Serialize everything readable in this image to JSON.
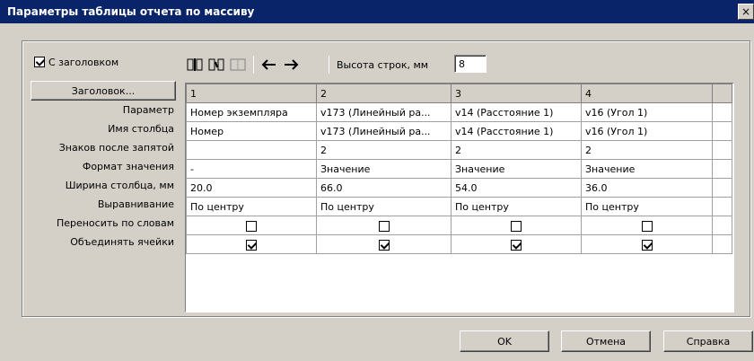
{
  "window": {
    "title": "Параметры таблицы отчета по массиву",
    "close_label": "×"
  },
  "header_checkbox": {
    "label": "С заголовком",
    "checked": true
  },
  "header_button_label": "Заголовок...",
  "row_height": {
    "label": "Высота строк, мм",
    "value": "8"
  },
  "row_labels": [
    "Параметр",
    "Имя столбца",
    "Знаков после запятой",
    "Формат значения",
    "Ширина столбца, мм",
    "Выравнивание",
    "Переносить по словам",
    "Объединять ячейки"
  ],
  "grid": {
    "headers": [
      "1",
      "2",
      "3",
      "4"
    ],
    "columns": [
      {
        "param": "Номер экземпляра",
        "name": "Номер",
        "decimals": "",
        "format": "-",
        "width": "20.0",
        "align": "По центру",
        "wrap": false,
        "merge": true
      },
      {
        "param": "v173 (Линейный ра...",
        "name": "v173 (Линейный ра...",
        "decimals": "2",
        "format": "Значение",
        "width": "66.0",
        "align": "По центру",
        "wrap": false,
        "merge": true
      },
      {
        "param": "v14 (Расстояние 1)",
        "name": "v14 (Расстояние 1)",
        "decimals": "2",
        "format": "Значение",
        "width": "54.0",
        "align": "По центру",
        "wrap": false,
        "merge": true
      },
      {
        "param": "v16 (Угол 1)",
        "name": "v16 (Угол 1)",
        "decimals": "2",
        "format": "Значение",
        "width": "36.0",
        "align": "По центру",
        "wrap": false,
        "merge": true
      }
    ]
  },
  "buttons": {
    "ok": "OK",
    "cancel": "Отмена",
    "help": "Справка"
  },
  "icons": [
    "insert-column-icon",
    "delete-column-icon",
    "merge-columns-icon",
    "arrow-left-icon",
    "arrow-right-icon"
  ],
  "colors": {
    "titlebar": "#0a246a",
    "face": "#d4d0c8"
  }
}
